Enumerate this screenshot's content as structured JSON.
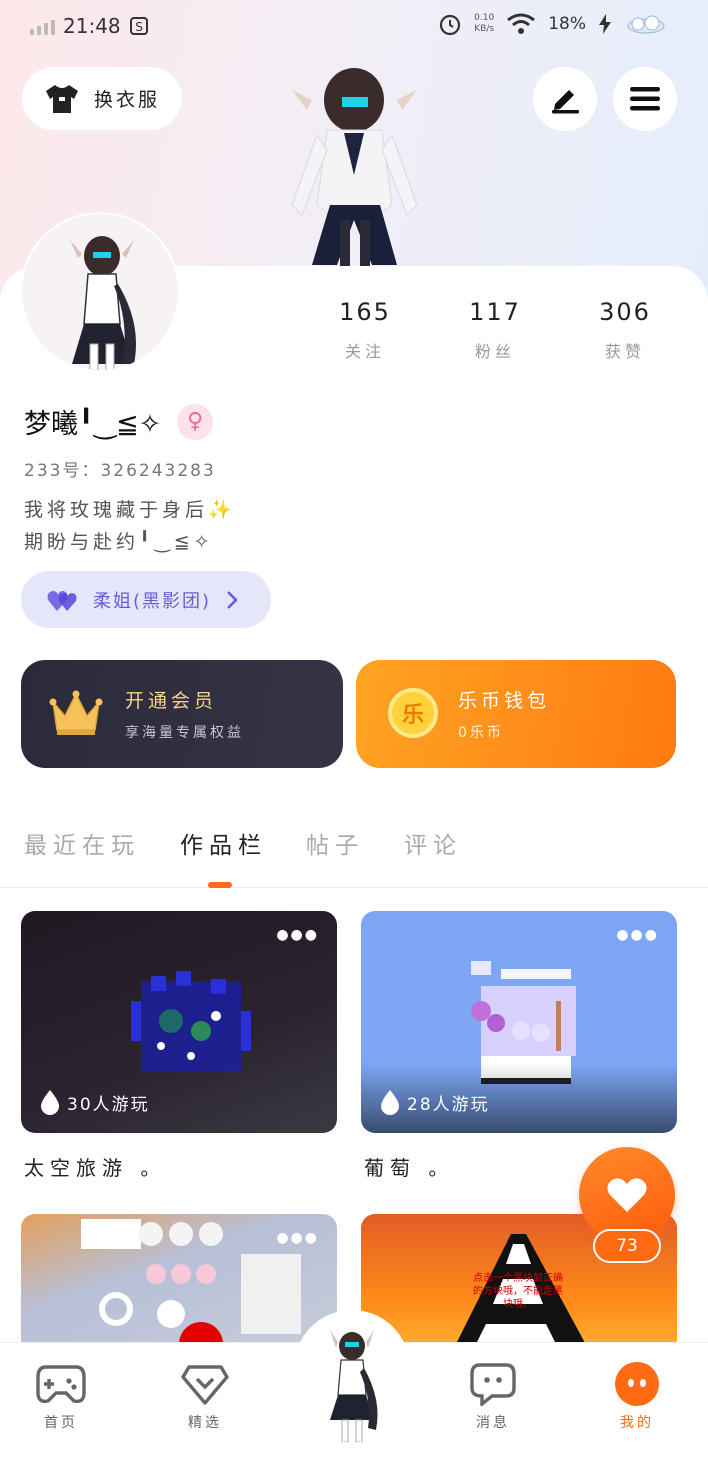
{
  "status_bar": {
    "time": "21:48",
    "net_speed_value": "0.10",
    "net_speed_unit": "KB/s",
    "battery": "18%"
  },
  "header": {
    "outfit_label": "换衣服",
    "edit_icon": "pencil-icon",
    "menu_icon": "hamburger-menu-icon"
  },
  "profile": {
    "nickname": "梦曦╹‿≦✧",
    "gender": "female",
    "uid": "233号：326243283",
    "bio_line1": "我将玫瑰藏于身后✨",
    "bio_line2": "期盼与赴约╹‿≦✧",
    "stats": [
      {
        "value": "165",
        "label": "关注"
      },
      {
        "value": "117",
        "label": "粉丝"
      },
      {
        "value": "306",
        "label": "获赞"
      }
    ],
    "group_label": "柔姐(黑影团)"
  },
  "cards": {
    "vip_title": "开通会员",
    "vip_sub": "享海量专属权益",
    "coin_title": "乐币钱包",
    "coin_sub": "0乐币",
    "coin_glyph": "乐"
  },
  "tabs": [
    "最近在玩",
    "作品栏",
    "帖子",
    "评论"
  ],
  "active_tab": "作品栏",
  "works": [
    {
      "title": "太空旅游 。",
      "plays": "30人游玩"
    },
    {
      "title": "葡萄 。",
      "plays": "28人游玩"
    },
    {
      "title": "",
      "plays": ""
    },
    {
      "title": "",
      "plays": "",
      "overlay_text": "点击一个黑块到正确的方块哦，不能走黑块哦。"
    }
  ],
  "like_fab": {
    "count": "73"
  },
  "bottom_nav": [
    {
      "label": "首页",
      "icon": "gamepad-icon"
    },
    {
      "label": "精选",
      "icon": "heart-gem-icon"
    },
    {
      "label": "消息",
      "icon": "chat-bubble-icon"
    },
    {
      "label": "我的",
      "icon": "face-icon"
    }
  ],
  "colors": {
    "accent": "#ff6a12",
    "vip_bg": "#2b2a3a",
    "coin_bg": "#ff8a1a",
    "group_bg": "#e6e6fb"
  }
}
